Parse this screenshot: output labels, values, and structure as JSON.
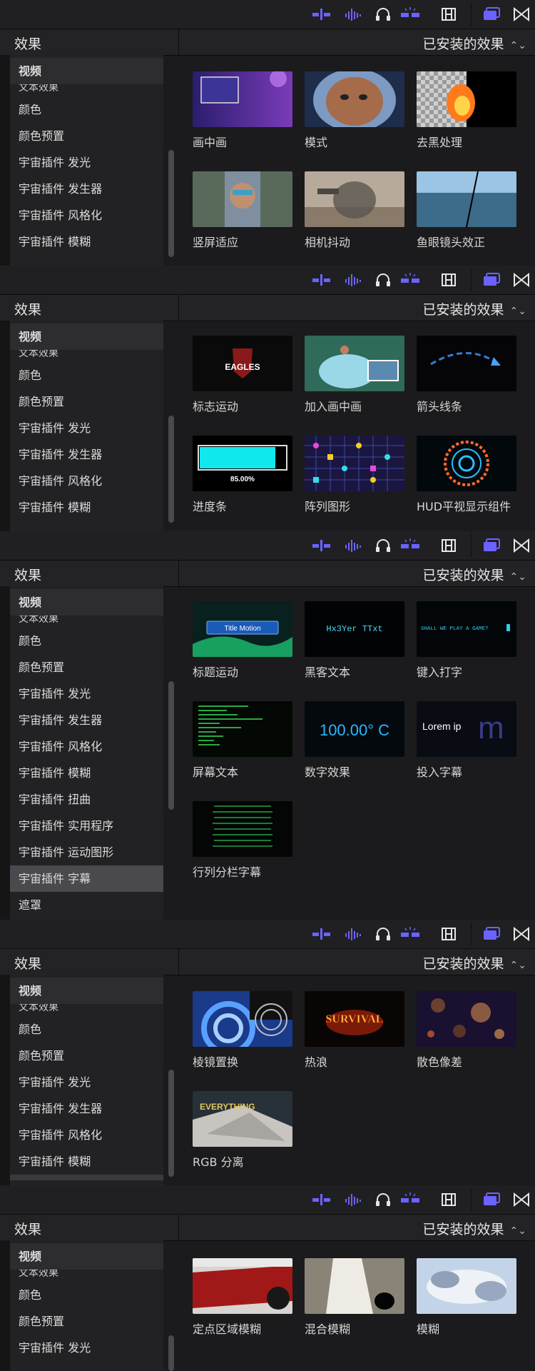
{
  "toolbar": {
    "icons": [
      "audio-meter-icon",
      "waveform-icon",
      "headphones-icon",
      "snapping-icon",
      "film-icon",
      "browser-toggle-icon",
      "transitions-icon"
    ]
  },
  "panels": [
    {
      "header": {
        "title": "效果",
        "select": "已安装的效果"
      },
      "sidebar": {
        "items": [
          "视频",
          "文本效果",
          "颜色",
          "颜色预置",
          "宇宙插件 发光",
          "宇宙插件 发生器",
          "宇宙插件 风格化",
          "宇宙插件 模糊"
        ],
        "selected": ""
      },
      "tiles": [
        "画中画",
        "模式",
        "去黑处理",
        "竖屏适应",
        "相机抖动",
        "鱼眼镜头效正"
      ]
    },
    {
      "header": {
        "title": "效果",
        "select": "已安装的效果"
      },
      "sidebar": {
        "items": [
          "视频",
          "文本效果",
          "颜色",
          "颜色预置",
          "宇宙插件 发光",
          "宇宙插件 发生器",
          "宇宙插件 风格化",
          "宇宙插件 模糊"
        ],
        "selected": ""
      },
      "tiles": [
        "标志运动",
        "加入画中画",
        "箭头线条",
        "进度条",
        "阵列图形",
        "HUD平视显示组件"
      ],
      "thumb_text": {
        "eagles": "EAGLES",
        "progress": "85.00%"
      }
    },
    {
      "header": {
        "title": "效果",
        "select": "已安装的效果"
      },
      "sidebar": {
        "items": [
          "视频",
          "文本效果",
          "颜色",
          "颜色预置",
          "宇宙插件 发光",
          "宇宙插件 发生器",
          "宇宙插件 风格化",
          "宇宙插件 模糊",
          "宇宙插件 扭曲",
          "宇宙插件 实用程序",
          "宇宙插件 运动图形",
          "宇宙插件 字幕",
          "遮罩"
        ],
        "selected": "宇宙插件 字幕"
      },
      "tiles": [
        "标题运动",
        "黑客文本",
        "键入打字",
        "屏幕文本",
        "数字效果",
        "投入字幕",
        "行列分栏字幕"
      ],
      "thumb_text": {
        "title_motion": "Title Motion",
        "hacker": "Hx3Yer TTxt",
        "typing": "SHALL WE PLAY A GAME?",
        "numbers": "100.00° C",
        "lorem": "Lorem ip",
        "m": "m"
      }
    },
    {
      "header": {
        "title": "效果",
        "select": "已安装的效果"
      },
      "sidebar": {
        "items": [
          "视频",
          "文本效果",
          "颜色",
          "颜色预置",
          "宇宙插件 发光",
          "宇宙插件 发生器",
          "宇宙插件 风格化",
          "宇宙插件 模糊"
        ],
        "selected": ""
      },
      "tiles": [
        "棱镜置换",
        "热浪",
        "散色像差",
        "RGB 分离"
      ],
      "thumb_text": {
        "survival": "SURVIVAL",
        "everything": "EVERYTHING"
      }
    },
    {
      "header": {
        "title": "效果",
        "select": "已安装的效果"
      },
      "sidebar": {
        "items": [
          "视频",
          "文本效果",
          "颜色",
          "颜色预置",
          "宇宙插件 发光"
        ],
        "selected": ""
      },
      "tiles": [
        "定点区域模糊",
        "混合模糊",
        "模糊"
      ]
    }
  ],
  "colors": {
    "accent": "#6b63ff",
    "bg": "#1b1b1d",
    "sidebar": "#222224",
    "selected": "#4a4a4e"
  }
}
